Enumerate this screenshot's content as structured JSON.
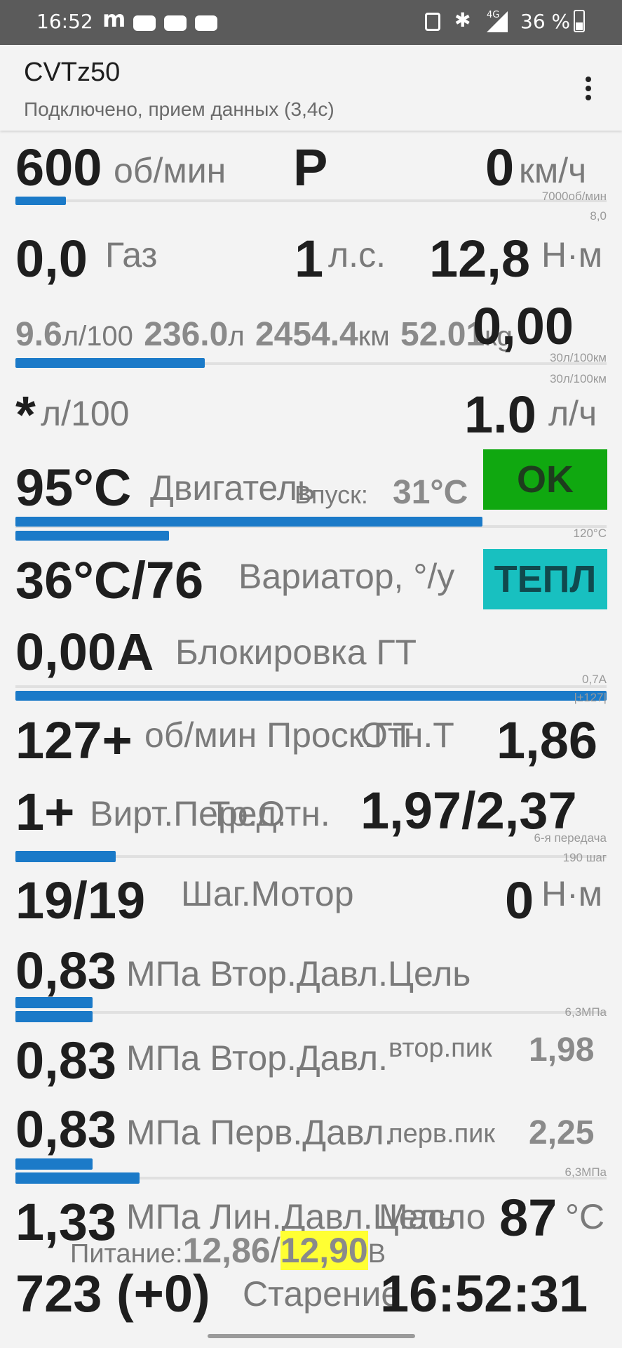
{
  "status": {
    "time": "16:52",
    "net": "4G",
    "battery": "36 %"
  },
  "app": {
    "title": "CVTz50",
    "subtitle": "Подключено, прием данных (3,4с)"
  },
  "r1": {
    "rpm": "600",
    "rpm_unit": "об/мин",
    "gear": "P",
    "speed": "0",
    "speed_unit": "км/ч",
    "rpm_max": "7000об/мин",
    "scale": "8,0"
  },
  "r2": {
    "gas": "0,0",
    "gas_label": "Газ",
    "hp": "1",
    "hp_unit": "л.с.",
    "torque": "12,8",
    "torque_unit": "Н·м"
  },
  "r3": {
    "f1": "9.6",
    "f1u": "л/100",
    "f2": "236.0",
    "f2u": "л",
    "f3": "2454.4",
    "f3u": "км",
    "f4": "52.01",
    "f4u": "кg",
    "overlay": "0,00",
    "scale1": "30л/100км",
    "scale2": "30л/100км"
  },
  "r4": {
    "inst": "*",
    "inst_unit": "л/100",
    "flow": "1.0",
    "flow_unit": "л/ч"
  },
  "r5": {
    "eng": "95°C",
    "eng_label": "Двигатель",
    "intake_label": "Впуск:",
    "intake": "31°C",
    "ok": "OK",
    "scale": "120°C"
  },
  "r6": {
    "cvt": "36°C/76",
    "cvt_label": "Вариатор, °/у",
    "warm": "ТЕПЛ"
  },
  "r7": {
    "lock": "0,00A",
    "lock_label": "Блокировка ГТ",
    "scale1": "0,7A",
    "scale2": "|±127|"
  },
  "r8": {
    "slip": "127+",
    "slip_label": "об/мин Проск.ГТ",
    "overlay": "Отн.Т",
    "ratio": "1,86"
  },
  "r9": {
    "virt": "1+",
    "virt_label": "Вирт.Перед.",
    "overlay": "Тр.Отн.",
    "ratio": "1,97/2,37",
    "scale1": "6-я передача",
    "scale2": "190 шаг"
  },
  "r10": {
    "step": "19/19",
    "step_label": "Шаг.Мотор",
    "nm": "0",
    "nm_unit": "Н·м"
  },
  "r11": {
    "v": "0,83",
    "u": "МПа Втор.Давл.Цель",
    "scale": "6,3МПа"
  },
  "r12": {
    "v": "0,83",
    "u": "МПа Втор.Давл.",
    "peak_label": "втор.пик",
    "peak": "1,98"
  },
  "r13": {
    "v": "0,83",
    "u": "МПа Перв.Давл.",
    "peak_label": "перв.пик",
    "peak": "2,25",
    "scale": "6,3МПа"
  },
  "r14": {
    "v": "1,33",
    "u": "МПа Лин.Давл.Цель",
    "oil_label": "Масло",
    "oil": "87",
    "oil_unit": "°C"
  },
  "r15": {
    "pwr_label": "Питание:",
    "pwr1": "12,86",
    "pwr_sep": "/",
    "pwr2": "12,90",
    "pwr_unit": "В"
  },
  "r16": {
    "age": "723 (+0)",
    "age_label": "Старение",
    "clock": "16:52:31"
  },
  "levels": {
    "rpm": 0.086,
    "fuel": 0.32,
    "eng_temp": 0.79,
    "intake_temp": 0.26,
    "lock": 1.0,
    "gear": 0.17,
    "p_target": 0.13,
    "p_sec": 0.13,
    "p_prim": 0.13,
    "p_line": 0.21
  },
  "colors": {
    "ok_bg": "#10a810",
    "warm_bg": "#18c0c0",
    "power_hl": "#ffff33",
    "bar": "#1b7ac8"
  }
}
